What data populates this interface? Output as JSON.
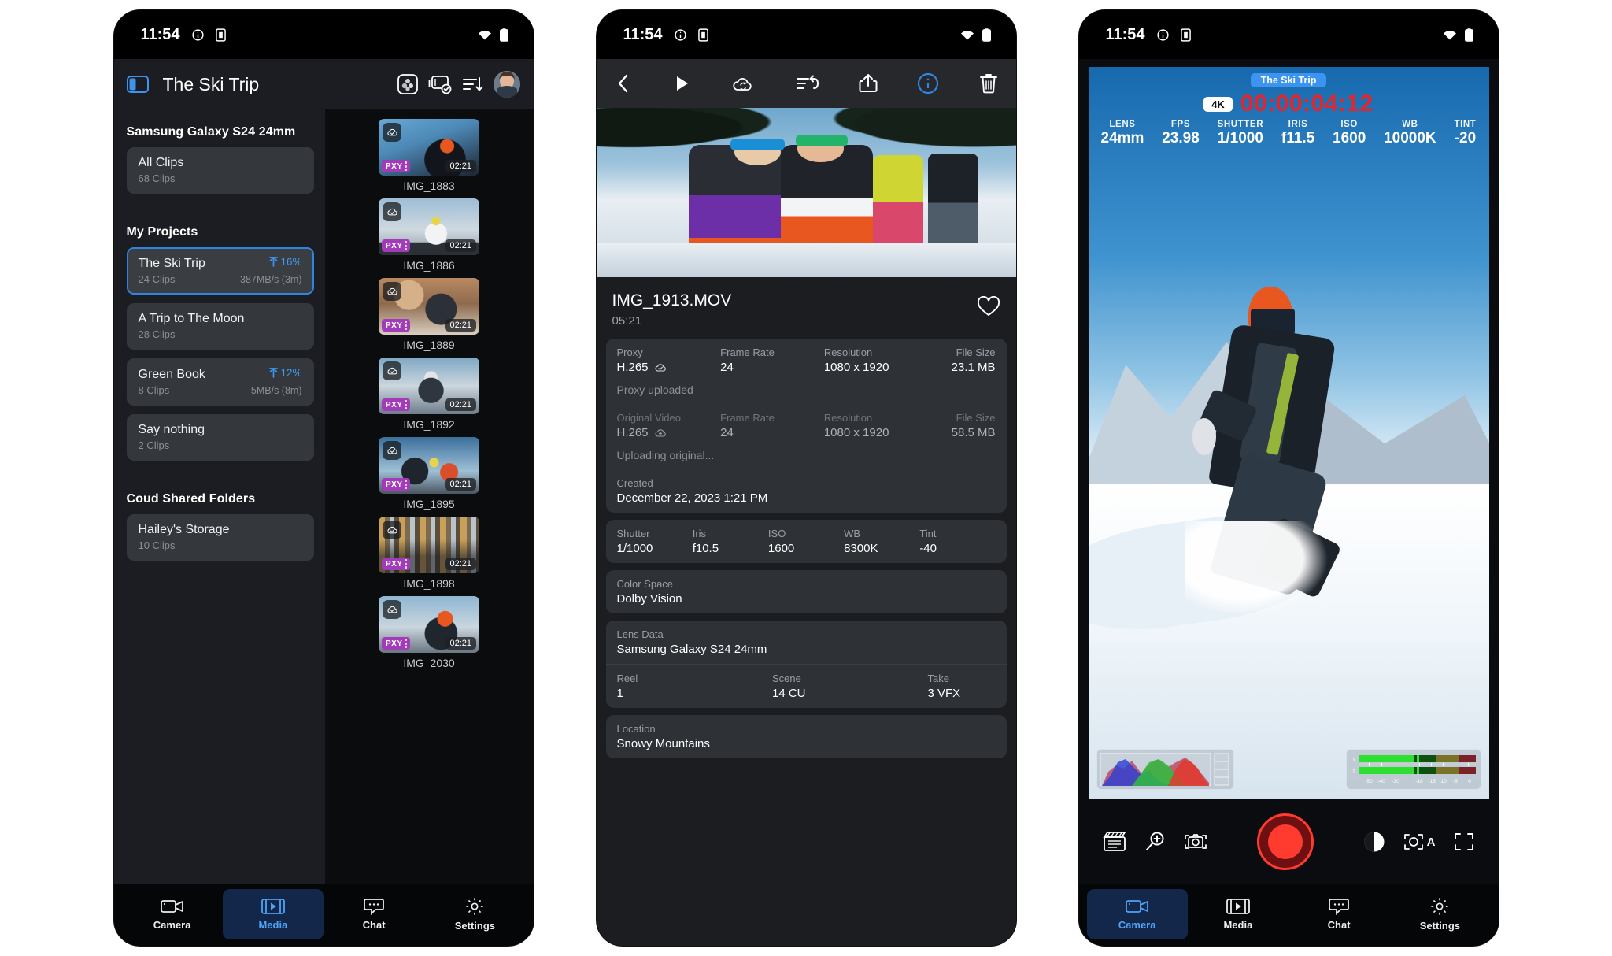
{
  "phone1": {
    "status": {
      "time": "11:54",
      "icons": [
        "info-icon",
        "sim-icon"
      ],
      "right_icons": [
        "wifi-icon",
        "battery-icon"
      ]
    },
    "appbar": {
      "title": "The Ski Trip",
      "sidebar_toggle": "sidebar-toggle-icon",
      "icons": [
        "grain-icon",
        "clips-check-icon",
        "sort-icon",
        "avatar"
      ]
    },
    "sidebar": {
      "device_heading": "Samsung Galaxy S24 24mm",
      "all_clips": {
        "title": "All Clips",
        "sub": "68 Clips"
      },
      "projects_heading": "My Projects",
      "projects": [
        {
          "title": "The Ski Trip",
          "sub": "24 Clips",
          "percent": "16%",
          "rate": "387MB/s (3m)",
          "selected": true
        },
        {
          "title": "A Trip to The Moon",
          "sub": "28 Clips",
          "percent": "",
          "rate": "",
          "selected": false
        },
        {
          "title": "Green Book",
          "sub": "8 Clips",
          "percent": "12%",
          "rate": "5MB/s (8m)",
          "selected": false
        },
        {
          "title": "Say nothing",
          "sub": "2 Clips",
          "percent": "",
          "rate": "",
          "selected": false
        }
      ],
      "shared_heading": "Coud Shared Folders",
      "shared": [
        {
          "title": "Hailey's Storage",
          "sub": "10 Clips"
        }
      ]
    },
    "clips": [
      {
        "name": "IMG_1883",
        "duration": "02:21",
        "badge": "cloud-check-icon",
        "tag": "PXY"
      },
      {
        "name": "IMG_1886",
        "duration": "02:21",
        "badge": "cloud-check-icon",
        "tag": "PXY"
      },
      {
        "name": "IMG_1889",
        "duration": "02:21",
        "badge": "cloud-check-icon",
        "tag": "PXY"
      },
      {
        "name": "IMG_1892",
        "duration": "02:21",
        "badge": "cloud-check-icon",
        "tag": "PXY"
      },
      {
        "name": "IMG_1895",
        "duration": "02:21",
        "badge": "cloud-check-icon",
        "tag": "PXY"
      },
      {
        "name": "IMG_1898",
        "duration": "02:21",
        "badge": "cloud-check-icon",
        "tag": "PXY"
      },
      {
        "name": "IMG_2030",
        "duration": "02:21",
        "badge": "cloud-check-icon",
        "tag": "PXY"
      }
    ],
    "tabs": [
      {
        "label": "Camera",
        "icon": "video-camera-icon",
        "active": false
      },
      {
        "label": "Media",
        "icon": "film-play-icon",
        "active": true
      },
      {
        "label": "Chat",
        "icon": "chat-bubble-icon",
        "active": false
      },
      {
        "label": "Settings",
        "icon": "gear-icon",
        "active": false
      }
    ]
  },
  "phone2": {
    "status": {
      "time": "11:54"
    },
    "toolbar": [
      "back-icon",
      "play-icon",
      "cloud-sync-icon",
      "undo-list-icon",
      "share-icon",
      "info-icon",
      "trash-icon"
    ],
    "file": {
      "name": "IMG_1913.MOV",
      "duration": "05:21",
      "favorite_icon": "heart-icon"
    },
    "meta": {
      "proxy": {
        "label": "Proxy",
        "codec": "H.265",
        "status_icon": "cloud-check-icon",
        "frame_rate_label": "Frame Rate",
        "frame_rate": "24",
        "resolution_label": "Resolution",
        "resolution": "1080 x 1920",
        "file_size_label": "File Size",
        "file_size": "23.1 MB",
        "note": "Proxy uploaded"
      },
      "original": {
        "label": "Original Video",
        "codec": "H.265",
        "status_icon": "cloud-uploading-icon",
        "frame_rate_label": "Frame Rate",
        "frame_rate": "24",
        "resolution_label": "Resolution",
        "resolution": "1080 x 1920",
        "file_size_label": "File Size",
        "file_size": "58.5 MB",
        "note": "Uploading original..."
      },
      "created": {
        "label": "Created",
        "value": "December 22, 2023 1:21 PM"
      },
      "exposure": [
        {
          "label": "Shutter",
          "value": "1/1000"
        },
        {
          "label": "Iris",
          "value": "f10.5"
        },
        {
          "label": "ISO",
          "value": "1600"
        },
        {
          "label": "WB",
          "value": "8300K"
        },
        {
          "label": "Tint",
          "value": "-40"
        }
      ],
      "color_space": {
        "label": "Color Space",
        "value": "Dolby Vision"
      },
      "lens_data": {
        "label": "Lens Data",
        "value": "Samsung Galaxy S24 24mm"
      },
      "slate": [
        {
          "label": "Reel",
          "value": "1"
        },
        {
          "label": "Scene",
          "value": "14 CU"
        },
        {
          "label": "Take",
          "value": "3 VFX"
        }
      ],
      "location": {
        "label": "Location",
        "value": "Snowy Mountains"
      }
    }
  },
  "phone3": {
    "status": {
      "time": "11:54"
    },
    "hud": {
      "project": "The Ski Trip",
      "quality": "4K",
      "timecode": "00:00:04:12",
      "params": [
        {
          "label": "LENS",
          "value": "24mm"
        },
        {
          "label": "FPS",
          "value": "23.98"
        },
        {
          "label": "SHUTTER",
          "value": "1/1000"
        },
        {
          "label": "IRIS",
          "value": "f11.5"
        },
        {
          "label": "ISO",
          "value": "1600"
        },
        {
          "label": "WB",
          "value": "10000K"
        },
        {
          "label": "TINT",
          "value": "-20"
        }
      ]
    },
    "scopes": {
      "histogram_name": "rgb-histogram",
      "audio_meters": {
        "channels": [
          "1",
          "2"
        ],
        "scale": [
          "-50",
          "-40",
          "-30",
          "-18",
          "-15",
          "-10",
          "-5",
          "0"
        ]
      }
    },
    "controls": {
      "left": [
        "slate-icon",
        "zoom-icon",
        "focus-frame-icon"
      ],
      "record": "record-button",
      "right": [
        "exposure-compensation-icon",
        "auto-exposure-icon",
        "fullscreen-icon"
      ],
      "auto_label": "A"
    },
    "tabs": [
      {
        "label": "Camera",
        "icon": "video-camera-icon",
        "active": true
      },
      {
        "label": "Media",
        "icon": "film-play-icon",
        "active": false
      },
      {
        "label": "Chat",
        "icon": "chat-bubble-icon",
        "active": false
      },
      {
        "label": "Settings",
        "icon": "gear-icon",
        "active": false
      }
    ]
  },
  "colors": {
    "accent": "#3d94f0",
    "record": "#ff3b30",
    "proxy_tag": "#a23bb8",
    "timecode": "#e4252b"
  }
}
